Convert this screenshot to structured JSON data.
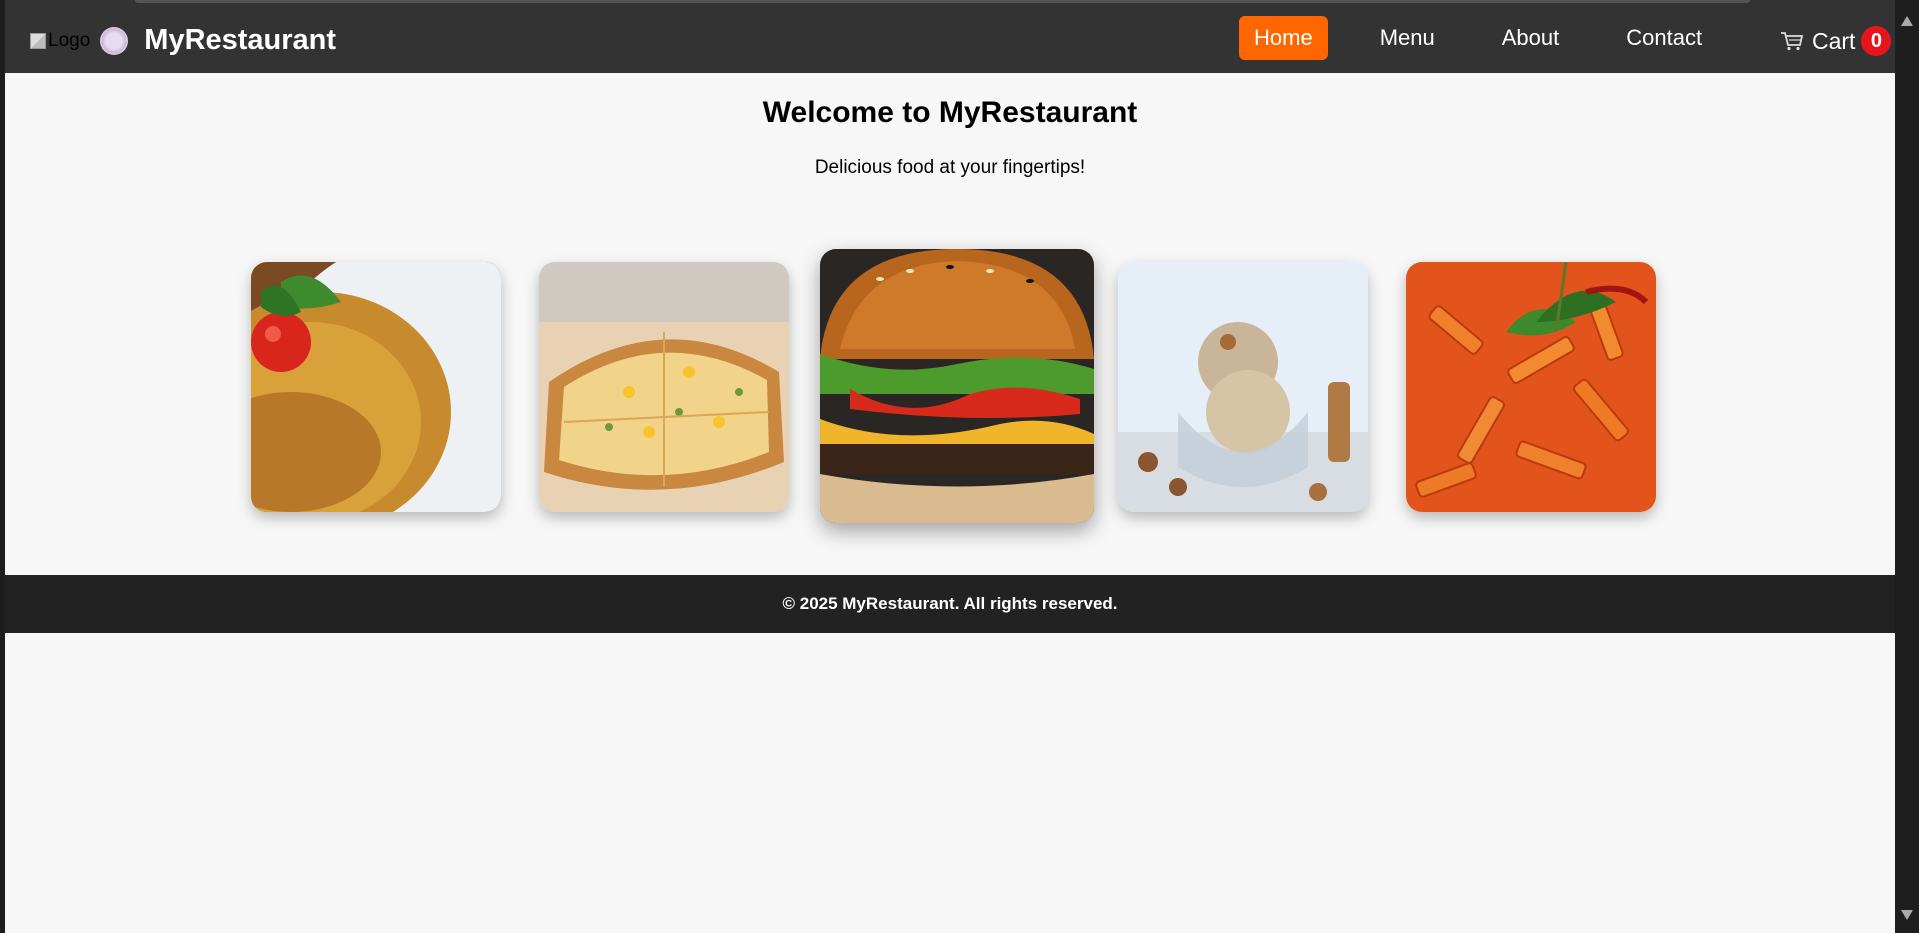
{
  "header": {
    "logo_alt": "Logo",
    "brand": "MyRestaurant",
    "nav": [
      {
        "label": "Home",
        "active": true
      },
      {
        "label": "Menu",
        "active": false
      },
      {
        "label": "About",
        "active": false
      },
      {
        "label": "Contact",
        "active": false
      }
    ],
    "cart_label": "Cart",
    "cart_count": "0"
  },
  "hero": {
    "title": "Welcome to MyRestaurant",
    "subtitle": "Delicious food at your fingertips!"
  },
  "gallery": {
    "items": [
      "rice-dish",
      "pizza",
      "burger",
      "ice-cream",
      "penne-pasta"
    ],
    "featured": "burger"
  },
  "footer": {
    "text": "© 2025 MyRestaurant. All rights reserved."
  },
  "colors": {
    "header_bg": "#333333",
    "accent": "#ff6600",
    "badge": "#e8141c",
    "footer_bg": "#222222",
    "page_bg": "#f7f7f7"
  }
}
